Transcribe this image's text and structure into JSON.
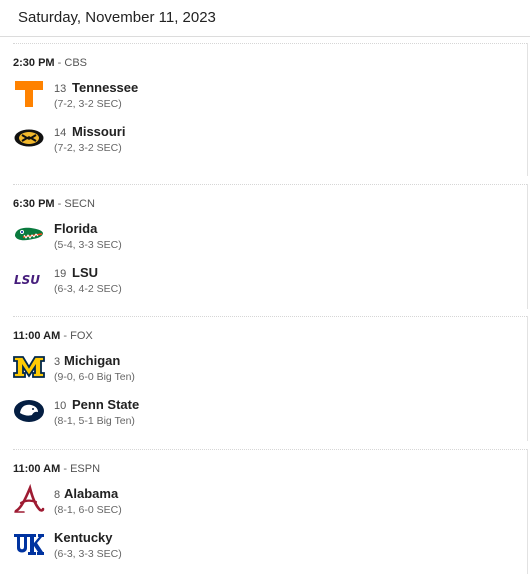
{
  "header": {
    "date": "Saturday, November 11, 2023"
  },
  "games": [
    {
      "time": "2:30 PM",
      "separator": "-",
      "network": "CBS",
      "teams": [
        {
          "rank": "13",
          "name": "Tennessee",
          "record": "(7-2, 3-2 SEC)",
          "logo_icon": "tennessee-power-t-icon",
          "color": "#ff8200"
        },
        {
          "rank": "14",
          "name": "Missouri",
          "record": "(7-2, 3-2 SEC)",
          "logo_icon": "missouri-tiger-icon",
          "color": "#f1b82d"
        }
      ]
    },
    {
      "time": "6:30 PM",
      "separator": "-",
      "network": "SECN",
      "teams": [
        {
          "rank": "",
          "name": "Florida",
          "record": "(5-4, 3-3 SEC)",
          "logo_icon": "florida-gator-icon",
          "color": "#0021a5"
        },
        {
          "rank": "19",
          "name": "LSU",
          "record": "(6-3, 4-2 SEC)",
          "logo_icon": "lsu-wordmark-icon",
          "color": "#461d7c",
          "logo_text": "LSU"
        }
      ]
    },
    {
      "time": "11:00 AM",
      "separator": "-",
      "network": "FOX",
      "teams": [
        {
          "rank": "3",
          "name": "Michigan",
          "record": "(9-0, 6-0 Big Ten)",
          "logo_icon": "michigan-block-m-icon",
          "color": "#00274c"
        },
        {
          "rank": "10",
          "name": "Penn State",
          "record": "(8-1, 5-1 Big Ten)",
          "logo_icon": "penn-state-lion-icon",
          "color": "#041e42"
        }
      ]
    },
    {
      "time": "11:00 AM",
      "separator": "-",
      "network": "ESPN",
      "teams": [
        {
          "rank": "8",
          "name": "Alabama",
          "record": "(8-1, 6-0 SEC)",
          "logo_icon": "alabama-script-a-icon",
          "color": "#9e1b32"
        },
        {
          "rank": "",
          "name": "Kentucky",
          "record": "(6-3, 3-3 SEC)",
          "logo_icon": "kentucky-uk-icon",
          "color": "#0033a0"
        }
      ]
    }
  ]
}
